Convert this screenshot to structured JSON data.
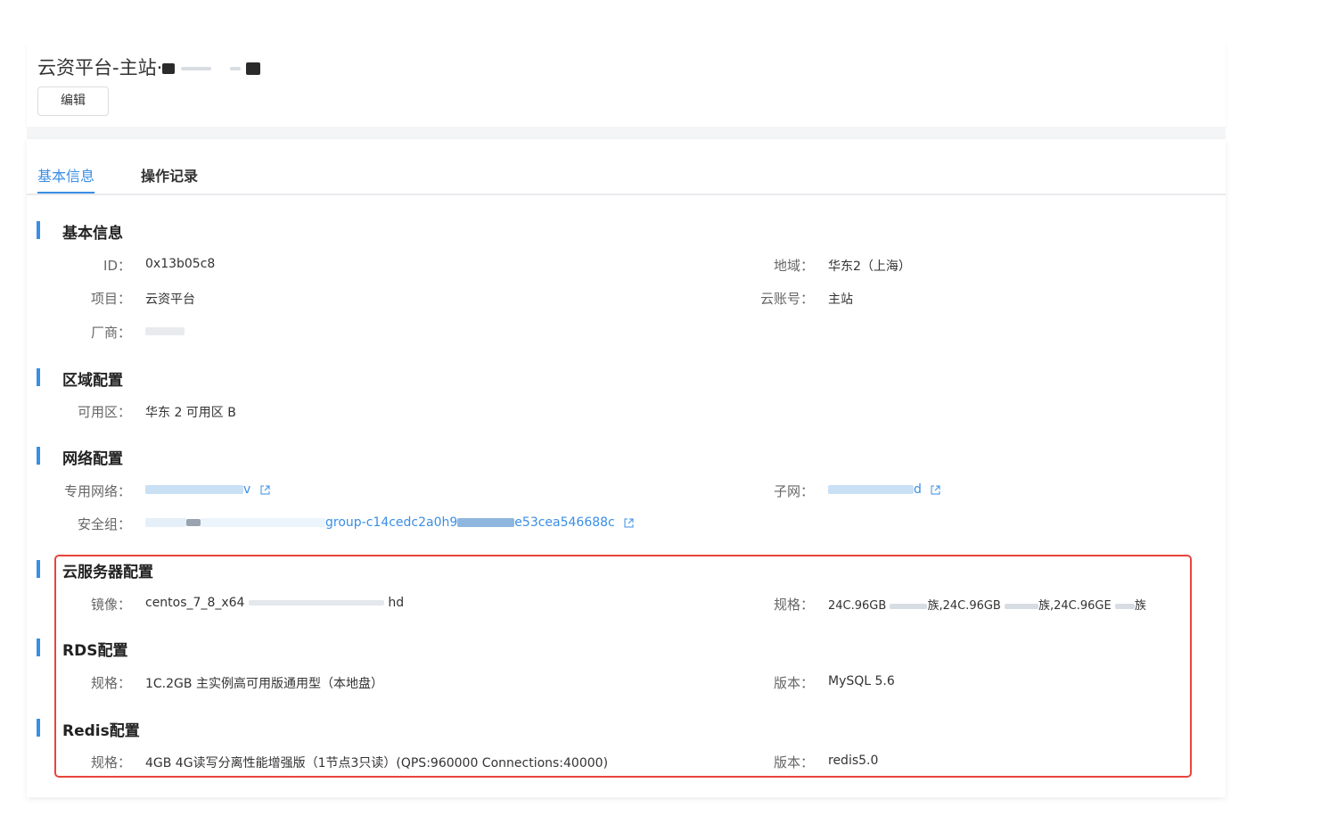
{
  "header": {
    "title": "云资平台-主站·",
    "edit_label": "编辑"
  },
  "tabs": [
    {
      "label": "基本信息",
      "active": true
    },
    {
      "label": "操作记录",
      "active": false
    }
  ],
  "sections": {
    "basic": {
      "title": "基本信息",
      "id_label": "ID：",
      "id_value": "0x13b05c8",
      "region_label": "地域：",
      "region_value": "华东2（上海）",
      "project_label": "项目：",
      "project_value": "云资平台",
      "account_label": "云账号：",
      "account_value": "主站",
      "vendor_label": "厂商：",
      "vendor_value": ""
    },
    "zone": {
      "title": "区域配置",
      "zone_label": "可用区：",
      "zone_value": "华东 2 可用区 B"
    },
    "network": {
      "title": "网络配置",
      "vpc_label": "专用网络：",
      "vpc_value": "v",
      "subnet_label": "子网：",
      "subnet_value": "d",
      "sg_label": "安全组：",
      "sg_value": "group-c14cedc2a0h9",
      "sg_value_tail": "e53cea546688c"
    },
    "server": {
      "title": "云服务器配置",
      "image_label": "镜像：",
      "image_value_start": "centos_7_8_x64",
      "image_value_end": "hd",
      "spec_label": "规格：",
      "spec_value": "24C.96GB",
      "spec_seg1": "族,24C.96GB",
      "spec_seg2": "族,24C.96GE",
      "spec_seg3": "族"
    },
    "rds": {
      "title": "RDS配置",
      "spec_label": "规格：",
      "spec_value": "1C.2GB 主实例高可用版通用型（本地盘）",
      "version_label": "版本：",
      "version_value": "MySQL 5.6"
    },
    "redis": {
      "title": "Redis配置",
      "spec_label": "规格：",
      "spec_value": "4GB 4G读写分离性能增强版（1节点3只读）(QPS:960000 Connections:40000)",
      "version_label": "版本：",
      "version_value": "redis5.0"
    }
  },
  "colors": {
    "accent": "#3a8ee6",
    "highlight": "#e8453c",
    "section_bar": "#3a8ee6"
  }
}
